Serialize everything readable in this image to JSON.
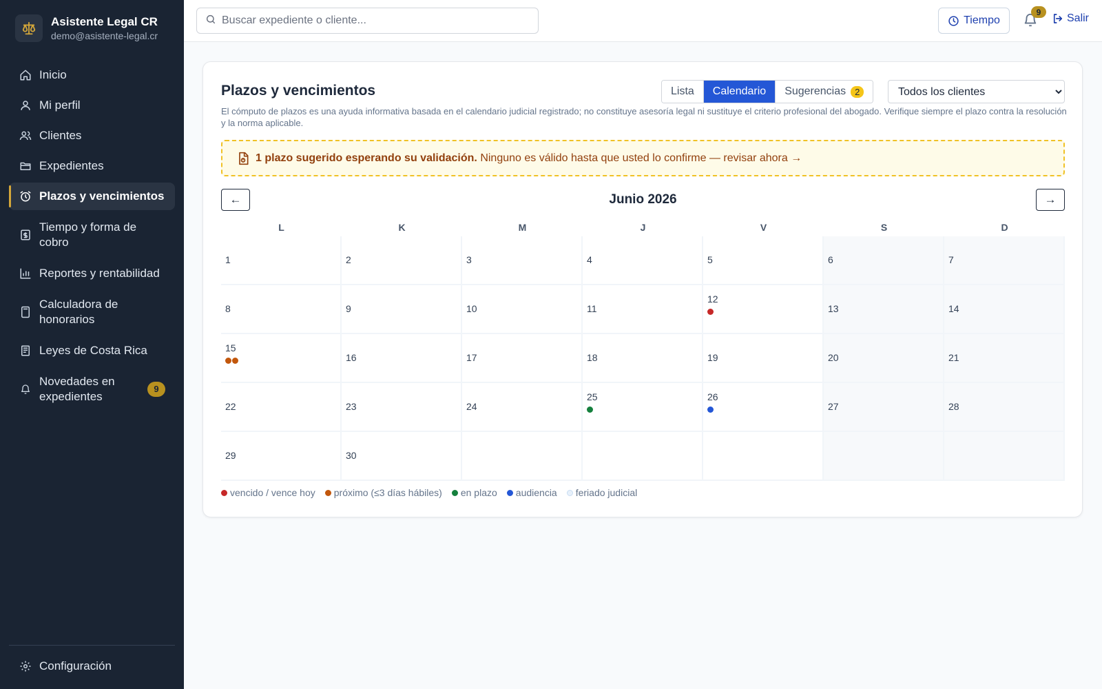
{
  "sidebar": {
    "brand_title": "Asistente Legal CR",
    "brand_email": "demo@asistente-legal.cr",
    "brand_icon": "scales-icon",
    "items": [
      {
        "label": "Inicio",
        "icon": "home-icon"
      },
      {
        "label": "Mi perfil",
        "icon": "user-icon"
      },
      {
        "label": "Clientes",
        "icon": "users-icon"
      },
      {
        "label": "Expedientes",
        "icon": "folder-icon"
      },
      {
        "label": "Plazos y vencimientos",
        "icon": "alarm-clock-icon",
        "active": true
      },
      {
        "label": "Tiempo y forma de cobro",
        "icon": "receipt-icon"
      },
      {
        "label": "Reportes y rentabilidad",
        "icon": "bar-chart-icon"
      },
      {
        "label": "Calculadora de honorarios",
        "icon": "calculator-icon"
      },
      {
        "label": "Leyes de Costa Rica",
        "icon": "book-icon"
      },
      {
        "label": "Novedades en expedientes",
        "icon": "bell-icon",
        "badge": "9"
      }
    ],
    "settings_label": "Configuración"
  },
  "topbar": {
    "search_placeholder": "Buscar expediente o cliente...",
    "time_label": "Tiempo",
    "notifications_count": "9",
    "logout_label": "Salir"
  },
  "card": {
    "title": "Plazos y vencimientos",
    "tabs": [
      {
        "label": "Lista",
        "active": false
      },
      {
        "label": "Calendario",
        "active": true
      },
      {
        "label": "Sugerencias",
        "active": false,
        "badge": "2"
      }
    ],
    "client_filter": "Todos los clientes",
    "disclaimer": "El cómputo de plazos es una ayuda informativa basada en el calendario judicial registrado; no constituye asesoría legal ni sustituye el criterio profesional del abogado. Verifique siempre el plazo contra la resolución y la norma aplicable.",
    "alert_strong": "1 plazo sugerido esperando su validación.",
    "alert_text": "Ninguno es válido hasta que usted lo confirme — revisar ahora →"
  },
  "calendar": {
    "prev_label": "←",
    "next_label": "→",
    "month_label": "Junio 2026",
    "weekdays": [
      "L",
      "K",
      "M",
      "J",
      "V",
      "S",
      "D"
    ],
    "first_weekday_offset": 0,
    "days_in_month": 30,
    "events": {
      "12": [
        "vencido"
      ],
      "15": [
        "proximo",
        "proximo"
      ],
      "25": [
        "en_plazo"
      ],
      "26": [
        "audiencia"
      ]
    },
    "legend": [
      {
        "key": "vencido",
        "label": "vencido / vence hoy",
        "color": "#c62828"
      },
      {
        "key": "proximo",
        "label": "próximo (≤3 días hábiles)",
        "color": "#c2570c"
      },
      {
        "key": "en_plazo",
        "label": "en plazo",
        "color": "#15803d"
      },
      {
        "key": "audiencia",
        "label": "audiencia",
        "color": "#2457d6"
      },
      {
        "key": "feriado",
        "label": "feriado judicial",
        "color": "#e8f1fb"
      }
    ]
  }
}
